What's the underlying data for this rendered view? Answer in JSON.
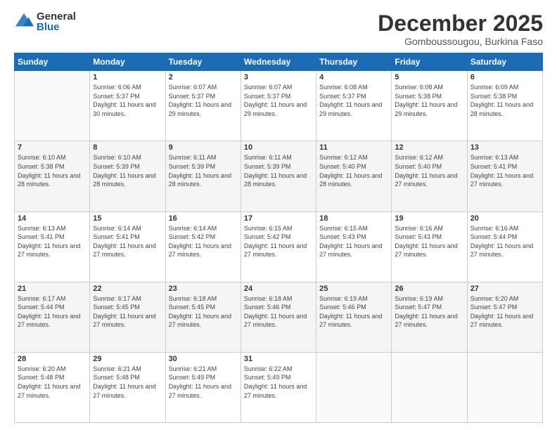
{
  "logo": {
    "general": "General",
    "blue": "Blue"
  },
  "header": {
    "month": "December 2025",
    "location": "Gomboussougou, Burkina Faso"
  },
  "weekdays": [
    "Sunday",
    "Monday",
    "Tuesday",
    "Wednesday",
    "Thursday",
    "Friday",
    "Saturday"
  ],
  "weeks": [
    [
      {
        "day": "",
        "sunrise": "",
        "sunset": "",
        "daylight": ""
      },
      {
        "day": "1",
        "sunrise": "6:06 AM",
        "sunset": "5:37 PM",
        "daylight": "11 hours and 30 minutes."
      },
      {
        "day": "2",
        "sunrise": "6:07 AM",
        "sunset": "5:37 PM",
        "daylight": "11 hours and 29 minutes."
      },
      {
        "day": "3",
        "sunrise": "6:07 AM",
        "sunset": "5:37 PM",
        "daylight": "11 hours and 29 minutes."
      },
      {
        "day": "4",
        "sunrise": "6:08 AM",
        "sunset": "5:37 PM",
        "daylight": "11 hours and 29 minutes."
      },
      {
        "day": "5",
        "sunrise": "6:08 AM",
        "sunset": "5:38 PM",
        "daylight": "11 hours and 29 minutes."
      },
      {
        "day": "6",
        "sunrise": "6:09 AM",
        "sunset": "5:38 PM",
        "daylight": "11 hours and 28 minutes."
      }
    ],
    [
      {
        "day": "7",
        "sunrise": "6:10 AM",
        "sunset": "5:38 PM",
        "daylight": "11 hours and 28 minutes."
      },
      {
        "day": "8",
        "sunrise": "6:10 AM",
        "sunset": "5:39 PM",
        "daylight": "11 hours and 28 minutes."
      },
      {
        "day": "9",
        "sunrise": "6:11 AM",
        "sunset": "5:39 PM",
        "daylight": "11 hours and 28 minutes."
      },
      {
        "day": "10",
        "sunrise": "6:11 AM",
        "sunset": "5:39 PM",
        "daylight": "11 hours and 28 minutes."
      },
      {
        "day": "11",
        "sunrise": "6:12 AM",
        "sunset": "5:40 PM",
        "daylight": "11 hours and 28 minutes."
      },
      {
        "day": "12",
        "sunrise": "6:12 AM",
        "sunset": "5:40 PM",
        "daylight": "11 hours and 27 minutes."
      },
      {
        "day": "13",
        "sunrise": "6:13 AM",
        "sunset": "5:41 PM",
        "daylight": "11 hours and 27 minutes."
      }
    ],
    [
      {
        "day": "14",
        "sunrise": "6:13 AM",
        "sunset": "5:41 PM",
        "daylight": "11 hours and 27 minutes."
      },
      {
        "day": "15",
        "sunrise": "6:14 AM",
        "sunset": "5:41 PM",
        "daylight": "11 hours and 27 minutes."
      },
      {
        "day": "16",
        "sunrise": "6:14 AM",
        "sunset": "5:42 PM",
        "daylight": "11 hours and 27 minutes."
      },
      {
        "day": "17",
        "sunrise": "6:15 AM",
        "sunset": "5:42 PM",
        "daylight": "11 hours and 27 minutes."
      },
      {
        "day": "18",
        "sunrise": "6:15 AM",
        "sunset": "5:43 PM",
        "daylight": "11 hours and 27 minutes."
      },
      {
        "day": "19",
        "sunrise": "6:16 AM",
        "sunset": "5:43 PM",
        "daylight": "11 hours and 27 minutes."
      },
      {
        "day": "20",
        "sunrise": "6:16 AM",
        "sunset": "5:44 PM",
        "daylight": "11 hours and 27 minutes."
      }
    ],
    [
      {
        "day": "21",
        "sunrise": "6:17 AM",
        "sunset": "5:44 PM",
        "daylight": "11 hours and 27 minutes."
      },
      {
        "day": "22",
        "sunrise": "6:17 AM",
        "sunset": "5:45 PM",
        "daylight": "11 hours and 27 minutes."
      },
      {
        "day": "23",
        "sunrise": "6:18 AM",
        "sunset": "5:45 PM",
        "daylight": "11 hours and 27 minutes."
      },
      {
        "day": "24",
        "sunrise": "6:18 AM",
        "sunset": "5:46 PM",
        "daylight": "11 hours and 27 minutes."
      },
      {
        "day": "25",
        "sunrise": "6:19 AM",
        "sunset": "5:46 PM",
        "daylight": "11 hours and 27 minutes."
      },
      {
        "day": "26",
        "sunrise": "6:19 AM",
        "sunset": "5:47 PM",
        "daylight": "11 hours and 27 minutes."
      },
      {
        "day": "27",
        "sunrise": "6:20 AM",
        "sunset": "5:47 PM",
        "daylight": "11 hours and 27 minutes."
      }
    ],
    [
      {
        "day": "28",
        "sunrise": "6:20 AM",
        "sunset": "5:48 PM",
        "daylight": "11 hours and 27 minutes."
      },
      {
        "day": "29",
        "sunrise": "6:21 AM",
        "sunset": "5:48 PM",
        "daylight": "11 hours and 27 minutes."
      },
      {
        "day": "30",
        "sunrise": "6:21 AM",
        "sunset": "5:49 PM",
        "daylight": "11 hours and 27 minutes."
      },
      {
        "day": "31",
        "sunrise": "6:22 AM",
        "sunset": "5:49 PM",
        "daylight": "11 hours and 27 minutes."
      },
      {
        "day": "",
        "sunrise": "",
        "sunset": "",
        "daylight": ""
      },
      {
        "day": "",
        "sunrise": "",
        "sunset": "",
        "daylight": ""
      },
      {
        "day": "",
        "sunrise": "",
        "sunset": "",
        "daylight": ""
      }
    ]
  ]
}
